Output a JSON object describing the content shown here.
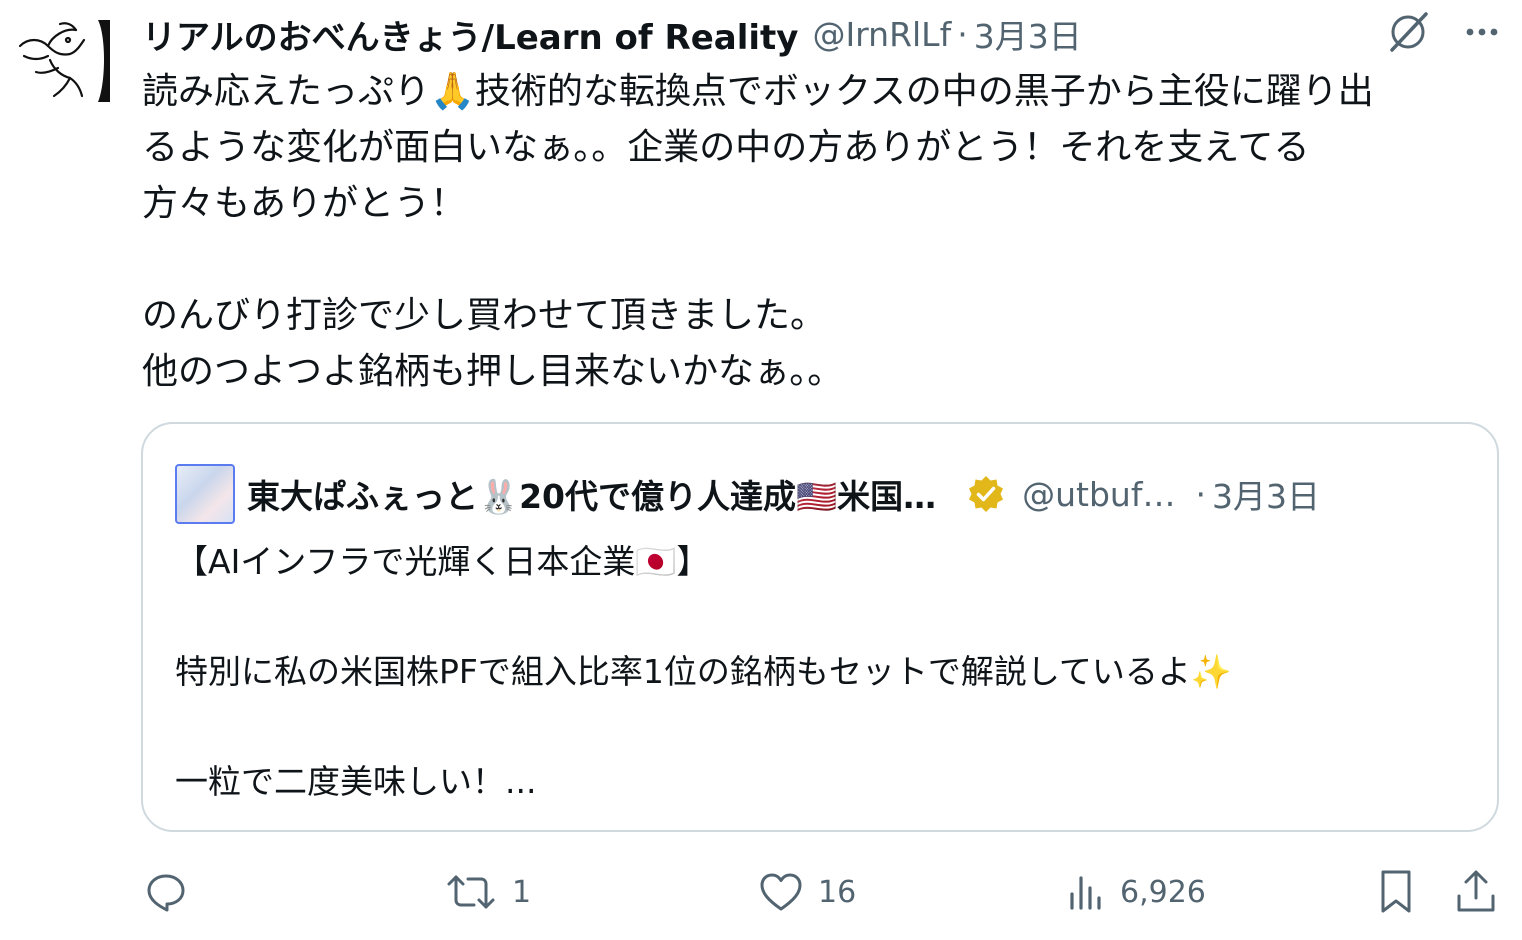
{
  "author": {
    "display_name": "リアルのおべんきょう/Learn of Reality",
    "handle": "@IrnRlLf",
    "separator": "·",
    "date": "3月3日"
  },
  "body_text": "読み応えたっぷり🙏技術的な転換点でボックスの中の黒子から主役に躍り出\nるような変化が面白いなぁ。。企業の中の方ありがとう！それを支えてる\n方々もありがとう！\n\nのんびり打診で少し買わせて頂きました。\n他のつよつよ銘柄も押し目来ないかなぁ。。",
  "quoted": {
    "display_name": "東大ぱふぇっと🐰20代で億り人達成🇺🇸米国…",
    "handle": "@utbuf…",
    "separator": "·",
    "date": "3月3日",
    "text": "【AIインフラで光輝く日本企業🇯🇵】\n\n特別に私の米国株PFで組入比率1位の銘柄もセットで解説しているよ✨\n\n一粒で二度美味しい！..."
  },
  "actions": {
    "reply_count": "",
    "retweet_count": "1",
    "like_count": "16",
    "views_count": "6,926"
  },
  "icons": [
    "reply-icon",
    "retweet-icon",
    "like-icon",
    "views-icon",
    "bookmark-icon",
    "share-icon",
    "grok-icon",
    "more-icon",
    "verified-icon"
  ],
  "colors": {
    "text": "#0f1419",
    "muted": "#536471",
    "border": "#cfd9de",
    "verified_gold": "#e2b719"
  }
}
